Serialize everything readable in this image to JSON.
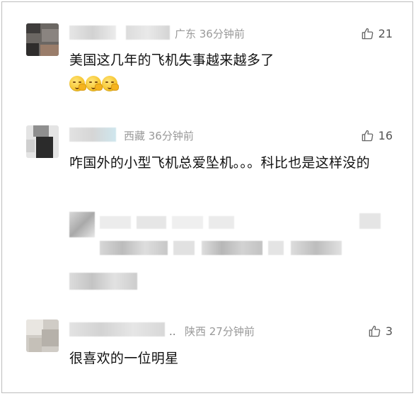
{
  "comments": [
    {
      "location_time": "广东 36分钟前",
      "likes": "21",
      "text": "美国这几年的飞机失事越来越多了",
      "emoji": [
        "thinking-face-icon",
        "thinking-face-icon",
        "thinking-face-icon"
      ]
    },
    {
      "location_time": "西藏 36分钟前",
      "likes": "16",
      "text": "咋国外的小型飞机总爱坠机。。。科比也是这样没的"
    },
    {
      "location_time": "陕西 27分钟前",
      "likes": "3",
      "text": "很喜欢的一位明星"
    }
  ],
  "colors": {
    "meta_gray": "#999999",
    "text": "#111111",
    "border": "#bdbdbd"
  },
  "icons": {
    "like": "thumbs-up-icon"
  }
}
